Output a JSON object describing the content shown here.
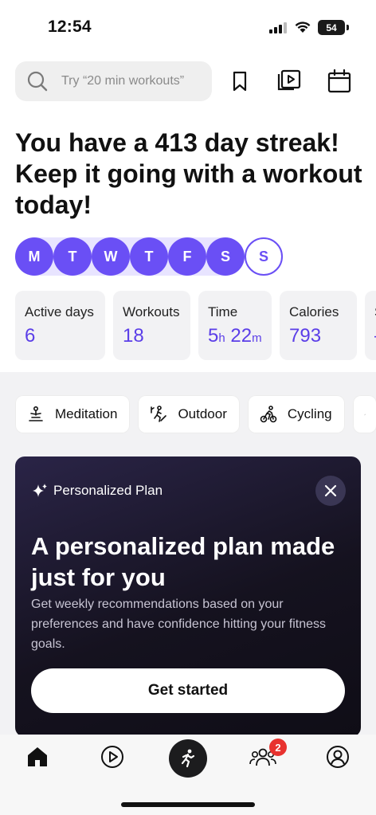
{
  "status_bar": {
    "time": "12:54",
    "battery": "54"
  },
  "header": {
    "search_placeholder": "Try “20 min workouts”",
    "icons": [
      "bookmark-icon",
      "video-library-icon",
      "calendar-icon"
    ]
  },
  "streak": {
    "title": "You have a 413 day streak! Keep it going with a workout today!",
    "days": [
      {
        "label": "M",
        "completed": true
      },
      {
        "label": "T",
        "completed": true
      },
      {
        "label": "W",
        "completed": true
      },
      {
        "label": "T",
        "completed": true
      },
      {
        "label": "F",
        "completed": true
      },
      {
        "label": "S",
        "completed": true
      },
      {
        "label": "S",
        "completed": false
      }
    ]
  },
  "stats": [
    {
      "label": "Active days",
      "value": "6"
    },
    {
      "label": "Workouts",
      "value": "18"
    },
    {
      "label": "Time",
      "hours": "5",
      "hours_unit": "h",
      "minutes": "22",
      "minutes_unit": "m"
    },
    {
      "label": "Calories",
      "value": "793"
    },
    {
      "label": "Se",
      "value": "–"
    }
  ],
  "categories": [
    {
      "label": "Meditation",
      "icon": "meditation-icon"
    },
    {
      "label": "Outdoor",
      "icon": "outdoor-icon"
    },
    {
      "label": "Cycling",
      "icon": "cycling-icon"
    }
  ],
  "plan_card": {
    "badge": "Personalized Plan",
    "title": "A personalized plan made just for you",
    "description": "Get weekly recommendations based on your preferences and have confidence hitting your fitness goals.",
    "cta": "Get started"
  },
  "tab_bar": {
    "tabs": [
      "home-icon",
      "play-icon",
      "workout-icon",
      "community-icon",
      "profile-icon"
    ],
    "community_badge": "2"
  },
  "colors": {
    "accent": "#6a4ff5",
    "card_dark": "#15121f",
    "badge_red": "#e8322f"
  }
}
